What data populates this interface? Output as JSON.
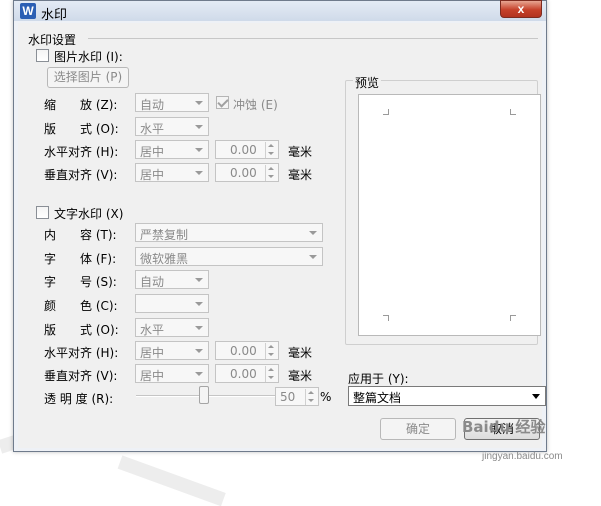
{
  "window": {
    "title": "水印",
    "app_icon_letter": "W",
    "close_label": "x"
  },
  "watermark_settings": {
    "group_title": "水印设置",
    "picture": {
      "checkbox_label": "图片水印 (I):",
      "checked": false,
      "select_button": "选择图片 (P)",
      "scale_label": "缩　　放 (Z):",
      "scale_value": "自动",
      "washout_label": "冲蚀 (E)",
      "washout_checked": true,
      "layout_label": "版　　式 (O):",
      "layout_value": "水平",
      "h_align_label": "水平对齐 (H):",
      "h_align_value": "居中",
      "h_offset": "0.00",
      "v_align_label": "垂直对齐 (V):",
      "v_align_value": "居中",
      "v_offset": "0.00",
      "unit": "毫米"
    },
    "text": {
      "checkbox_label": "文字水印 (X)",
      "checked": false,
      "content_label": "内　　容 (T):",
      "content_value": "严禁复制",
      "font_label": "字　　体 (F):",
      "font_value": "微软雅黑",
      "size_label": "字　　号 (S):",
      "size_value": "自动",
      "color_label": "颜　　色 (C):",
      "color_value": "",
      "layout_label": "版　　式 (O):",
      "layout_value": "水平",
      "h_align_label": "水平对齐 (H):",
      "h_align_value": "居中",
      "h_offset": "0.00",
      "v_align_label": "垂直对齐 (V):",
      "v_align_value": "居中",
      "v_offset": "0.00",
      "unit": "毫米",
      "transparency_label": "透 明 度 (R):",
      "transparency_value": "50",
      "transparency_unit": "%"
    }
  },
  "preview": {
    "label": "预览"
  },
  "apply_to": {
    "label": "应用于 (Y):",
    "value": "整篇文档"
  },
  "buttons": {
    "ok": "确定",
    "cancel": "取消"
  },
  "site_watermark": {
    "logo": "Baidu 经验",
    "url": "jingyan.baidu.com"
  },
  "colors": {
    "title_bar": "#cfdae9",
    "close_button": "#c6412a",
    "dialog_bg": "#f0f0f0",
    "disabled_text": "#8a8a8a"
  }
}
